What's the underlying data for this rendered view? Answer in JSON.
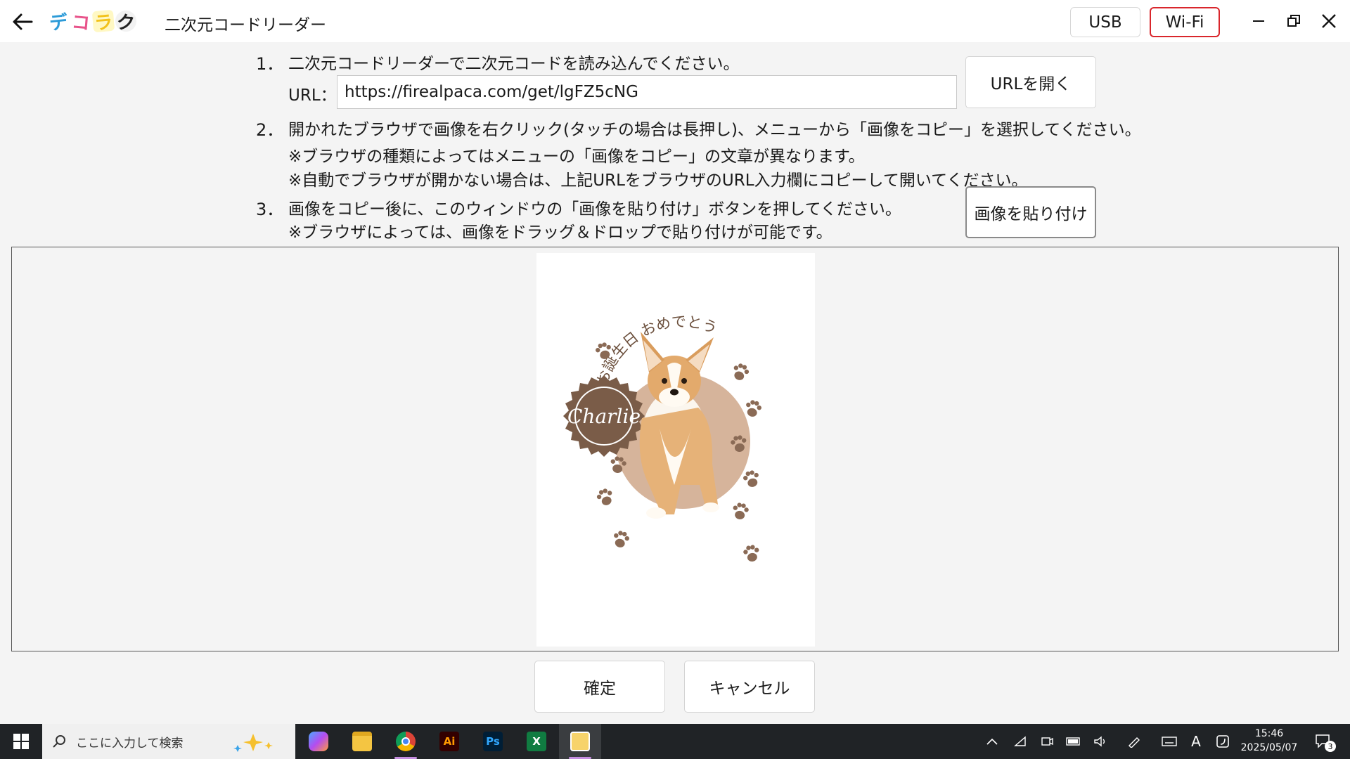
{
  "titlebar": {
    "logo_chars": [
      "デ",
      "コ",
      "ラ",
      "ク"
    ],
    "app_title": "二次元コードリーダー",
    "usb_label": "USB",
    "wifi_label": "Wi-Fi",
    "accent_color": "#d9262c"
  },
  "steps": {
    "step1_num": "1．",
    "step1_text": "二次元コードリーダーで二次元コードを読み込んでください。",
    "url_label": "URL：",
    "url_value": "https://firealpaca.com/get/lgFZ5cNG",
    "open_url_button": "URLを開く",
    "step2_num": "2．",
    "step2_text": "開かれたブラウザで画像を右クリック(タッチの場合は長押し)、メニューから「画像をコピー」を選択してください。",
    "step2_note1": "※ブラウザの種類によってはメニューの「画像をコピー」の文章が異なります。",
    "step2_note2": "※自動でブラウザが開かない場合は、上記URLをブラウザのURL入力欄にコピーして開いてください。",
    "step3_num": "3．",
    "step3_text": "画像をコピー後に、このウィンドウの「画像を貼り付け」ボタンを押してください。",
    "step3_note": "※ブラウザによっては、画像をドラッグ＆ドロップで貼り付けが可能です。",
    "paste_button": "画像を貼り付け"
  },
  "preview": {
    "arc_text": "お誕生日 おめでとう",
    "badge_name": "Charlie",
    "colors": {
      "brown": "#7a5c48",
      "tan": "#d6b49b",
      "paw": "#8a6a55"
    }
  },
  "actions": {
    "confirm_button": "確定",
    "cancel_button": "キャンセル"
  },
  "taskbar": {
    "search_placeholder": "ここに入力して検索",
    "apps": [
      "copilot-icon",
      "file-explorer-icon",
      "chrome-icon",
      "illustrator-icon",
      "photoshop-icon",
      "excel-icon",
      "notes-app-icon"
    ],
    "ai_label": "Ai",
    "ps_label": "Ps",
    "x_label": "X",
    "ime_label": "A",
    "time": "15:46",
    "date": "2025/05/07",
    "notification_count": "3"
  }
}
